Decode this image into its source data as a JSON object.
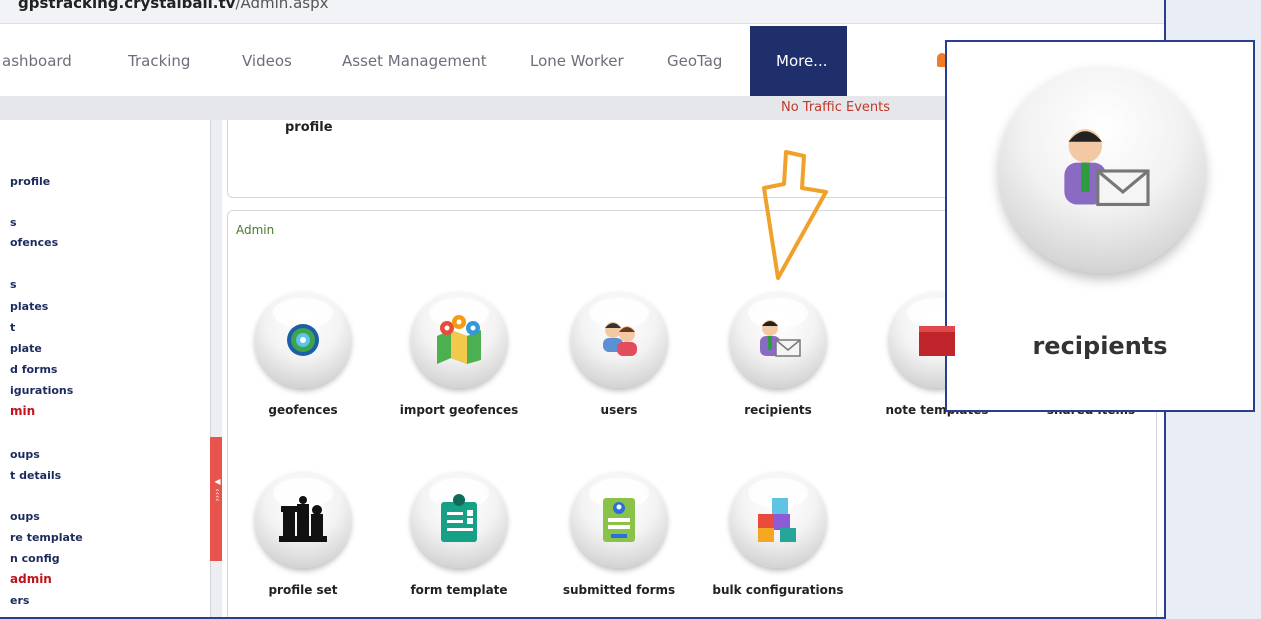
{
  "browser": {
    "url_host": "gpstracking.crystalball.tv",
    "url_path": "/Admin.aspx"
  },
  "nav": {
    "items": [
      "ashboard",
      "Tracking",
      "Videos",
      "Asset Management",
      "Lone Worker",
      "GeoTag"
    ],
    "active": "More..."
  },
  "status": {
    "traffic": "No Traffic Events"
  },
  "sidebar": {
    "items": [
      "profile",
      "s",
      "ofences",
      "s",
      "plates",
      "t",
      "plate",
      "d forms",
      "igurations",
      "min",
      "oups",
      "t details",
      "oups",
      "re template",
      "n config",
      "admin",
      "ers"
    ]
  },
  "profile_panel": {
    "label": "profile"
  },
  "admin": {
    "title": "Admin",
    "tiles_row1": [
      "geofences",
      "import geofences",
      "users",
      "recipients",
      "note templates",
      "shared items"
    ],
    "tiles_row2": [
      "profile set",
      "form template",
      "submitted forms",
      "bulk configurations"
    ]
  },
  "zoom": {
    "label": "recipients",
    "icon": "recipients-icon"
  },
  "colors": {
    "nav_active": "#1e2f6b",
    "accent_red": "#c0131c",
    "arrow": "#f0a12a",
    "callout_border": "#2b3d8f"
  }
}
